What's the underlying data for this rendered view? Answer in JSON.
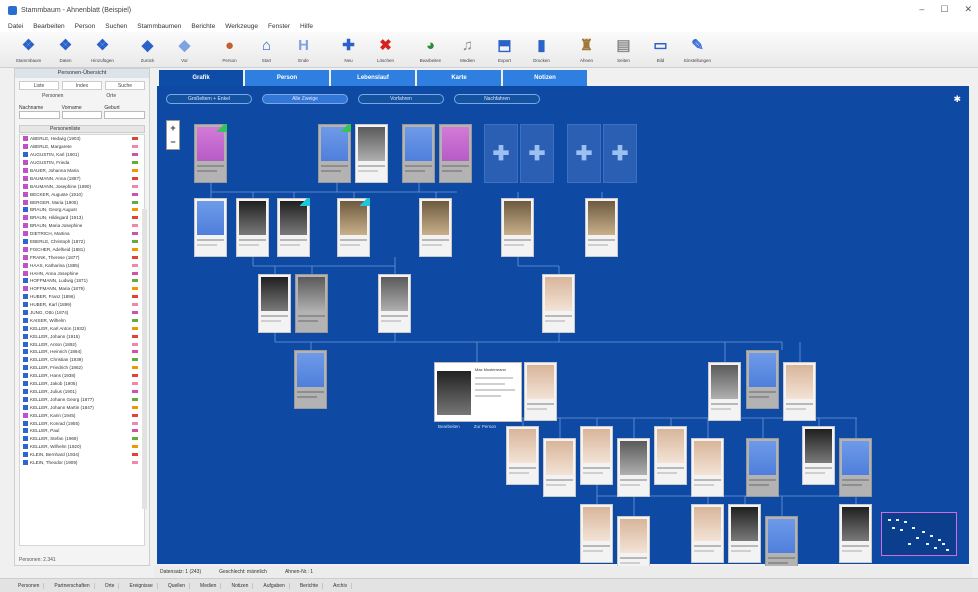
{
  "window": {
    "title": "Stammbaum - Ahnenblatt (Beispiel)"
  },
  "menu": [
    "Datei",
    "Bearbeiten",
    "Person",
    "Suchen",
    "Stammbaumen",
    "Berichte",
    "Werkzeuge",
    "Fenster",
    "Hilfe"
  ],
  "toolbar": [
    {
      "label": "Stammbaum",
      "icon": "family-icon",
      "color": "#2a62c9",
      "glyph": "❖"
    },
    {
      "label": "Daten",
      "icon": "people-icon",
      "color": "#2a62c9",
      "glyph": "❖"
    },
    {
      "label": "Hinzufügen",
      "icon": "add-people-icon",
      "color": "#2a62c9",
      "glyph": "❖"
    },
    {
      "label": "Zurück",
      "icon": "arrow-left-icon",
      "color": "#2a62c9",
      "glyph": "◆"
    },
    {
      "label": "Vor",
      "icon": "arrow-right-icon",
      "color": "#7ea3e0",
      "glyph": "◆"
    },
    {
      "label": "Person",
      "icon": "person-icon",
      "color": "#c0622d",
      "glyph": "●"
    },
    {
      "label": "Start",
      "icon": "home-icon",
      "color": "#2a62c9",
      "glyph": "⌂"
    },
    {
      "label": "Ende",
      "icon": "end-icon",
      "color": "#7ea3e0",
      "glyph": "H"
    },
    {
      "label": "Neu",
      "icon": "add-icon",
      "color": "#2a62c9",
      "glyph": "✚"
    },
    {
      "label": "Löschen",
      "icon": "delete-icon",
      "color": "#d62222",
      "glyph": "✖"
    },
    {
      "label": "Bearbeiten",
      "icon": "edit-icon",
      "color": "#2f8a3c",
      "glyph": "◕"
    },
    {
      "label": "Medien",
      "icon": "media-icon",
      "color": "#8a8a8a",
      "glyph": "♫"
    },
    {
      "label": "Export",
      "icon": "export-icon",
      "color": "#2a62c9",
      "glyph": "⬒"
    },
    {
      "label": "Drucken",
      "icon": "print-icon",
      "color": "#2a62c9",
      "glyph": "▮"
    },
    {
      "label": "Ahnen",
      "icon": "tree-icon",
      "color": "#a0793a",
      "glyph": "♜"
    },
    {
      "label": "Seiten",
      "icon": "pages-icon",
      "color": "#8a8a8a",
      "glyph": "▤"
    },
    {
      "label": "Bild",
      "icon": "frame-icon",
      "color": "#2a62c9",
      "glyph": "▭"
    },
    {
      "label": "Einstellungen",
      "icon": "wand-icon",
      "color": "#3a6ed6",
      "glyph": "✎"
    }
  ],
  "left_panel": {
    "header": "Personen-Übersicht",
    "tabs": [
      "Liste",
      "Index",
      "Suche"
    ],
    "subtabs": [
      "Personen",
      "Orte"
    ],
    "search_cols": [
      "Nachname",
      "Vorname",
      "Geburt"
    ],
    "list_header": "Personenliste",
    "items": [
      {
        "name": "ABERLE, Hedwig (1903)",
        "sex": "f"
      },
      {
        "name": "ABERLE, Margarete",
        "sex": "f"
      },
      {
        "name": "AUGUSTIN, Karl (1901)",
        "sex": "m"
      },
      {
        "name": "AUGUSTIN, Frieda",
        "sex": "f"
      },
      {
        "name": "BAUER, Johanna Maria",
        "sex": "f"
      },
      {
        "name": "BAUMANN, Anna (1887)",
        "sex": "f"
      },
      {
        "name": "BAUMANN, Josephine (1890)",
        "sex": "f"
      },
      {
        "name": "BECKER, Auguste (1910)",
        "sex": "f"
      },
      {
        "name": "BERGER, Maria (1905)",
        "sex": "f"
      },
      {
        "name": "BRAUN, Georg August",
        "sex": "m"
      },
      {
        "name": "BRAUN, Hildegard (1913)",
        "sex": "f"
      },
      {
        "name": "BRAUN, Maria Josephine",
        "sex": "f"
      },
      {
        "name": "DIETRICH, Martina",
        "sex": "f"
      },
      {
        "name": "EBERLE, Christoph (1872)",
        "sex": "m"
      },
      {
        "name": "FISCHER, Adelheid (1881)",
        "sex": "f"
      },
      {
        "name": "FRANK, Therese (1877)",
        "sex": "f"
      },
      {
        "name": "HAAS, Katharina (1885)",
        "sex": "f"
      },
      {
        "name": "HAHN, Anna Josephine",
        "sex": "f"
      },
      {
        "name": "HOFFMANN, Ludwig (1871)",
        "sex": "m"
      },
      {
        "name": "HOFFMANN, Maria (1879)",
        "sex": "f"
      },
      {
        "name": "HUBER, Franz (1896)",
        "sex": "m"
      },
      {
        "name": "HUBER, Karl (1899)",
        "sex": "m"
      },
      {
        "name": "JUNG, Otto (1874)",
        "sex": "m"
      },
      {
        "name": "KAISER, Wilhelm",
        "sex": "m"
      },
      {
        "name": "KELLER, Karl Anton (1932)",
        "sex": "m"
      },
      {
        "name": "KELLER, Johann (1915)",
        "sex": "m"
      },
      {
        "name": "KELLER, Anton (1892)",
        "sex": "m"
      },
      {
        "name": "KELLER, Heinrich (1894)",
        "sex": "m"
      },
      {
        "name": "KELLER, Christian (1939)",
        "sex": "m"
      },
      {
        "name": "KELLER, Friedrich (1862)",
        "sex": "m"
      },
      {
        "name": "KELLER, Hans (1938)",
        "sex": "m"
      },
      {
        "name": "KELLER, Jakob (1905)",
        "sex": "m"
      },
      {
        "name": "KELLER, Julius (1901)",
        "sex": "m"
      },
      {
        "name": "KELLER, Johann Georg (1877)",
        "sex": "m"
      },
      {
        "name": "KELLER, Johann Martin (1847)",
        "sex": "m"
      },
      {
        "name": "KELLER, Karin (1945)",
        "sex": "f"
      },
      {
        "name": "KELLER, Konrad (1955)",
        "sex": "m"
      },
      {
        "name": "KELLER, Paul",
        "sex": "m"
      },
      {
        "name": "KELLER, Stefan (1969)",
        "sex": "m"
      },
      {
        "name": "KELLER, Wilhelm (1920)",
        "sex": "m"
      },
      {
        "name": "KLEIN, Bernhard (1934)",
        "sex": "m"
      },
      {
        "name": "KLEIN, Theodor (1909)",
        "sex": "m"
      }
    ],
    "footer": "Personen: 2.341"
  },
  "view_tabs": [
    {
      "label": "Grafik",
      "active": true
    },
    {
      "label": "Person",
      "active": false
    },
    {
      "label": "Lebenslauf",
      "active": false
    },
    {
      "label": "Karte",
      "active": false
    },
    {
      "label": "Notizen",
      "active": false
    }
  ],
  "canvas_tabs": [
    {
      "label": "Großeltern + Enkel",
      "active": false
    },
    {
      "label": "Alle Zweige",
      "active": true
    },
    {
      "label": "Vorfahren",
      "active": false
    },
    {
      "label": "Nachfahren",
      "active": false
    }
  ],
  "zoom": {
    "plus": "+",
    "minus": "−"
  },
  "add_glyph": "✚",
  "featured_person": {
    "name": "Max Mustermann"
  },
  "featured_links": [
    "Bearbeiten",
    "Zur Person"
  ],
  "status_bar": [
    "Datensatz: 1 (243)",
    "Geschlecht: männlich",
    "Ahnen-Nr.: 1"
  ],
  "bottom_tabs": [
    "Personen",
    "Partnerschaften",
    "Orte",
    "Ereignisse",
    "Quellen",
    "Medien",
    "Notizen",
    "Aufgaben",
    "Berichte",
    "Archiv"
  ]
}
